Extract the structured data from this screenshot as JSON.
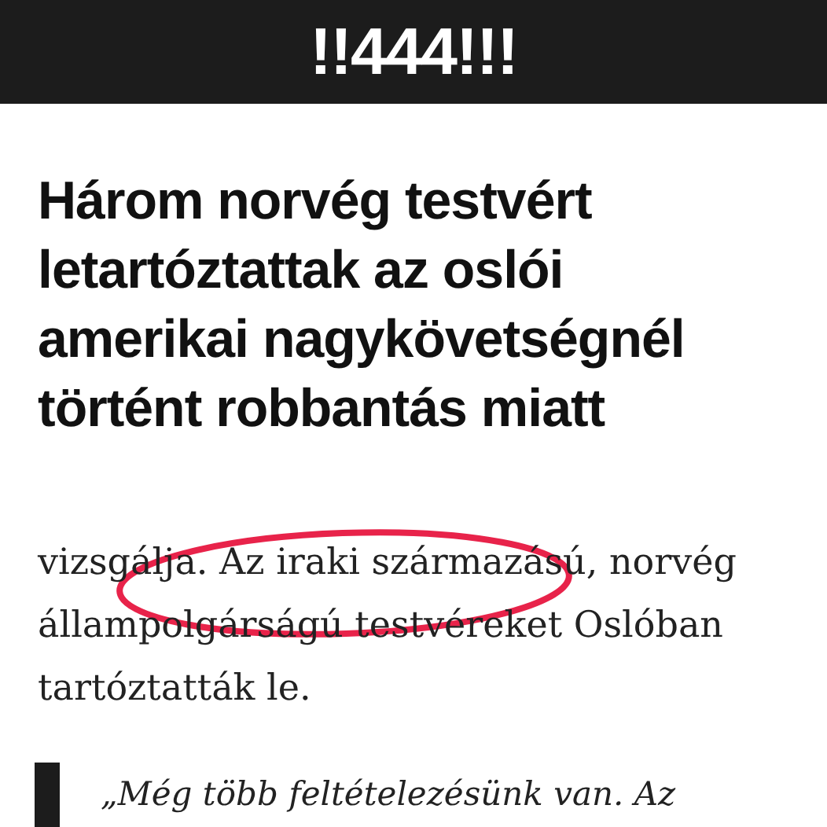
{
  "header": {
    "logo": "!!444!!!"
  },
  "article": {
    "headline": "Három norvég testvért letartóztattak az oslói amerikai nagykövetségnél történt robbantás miatt",
    "paragraph": "vizsgálja. Az iraki származású, norvég állampolgárságú testvéreket Oslóban tartóztatták le.",
    "quote": "„Még több feltételezésünk van. Az"
  },
  "annotation": {
    "kind": "circle",
    "color": "#e8234a"
  }
}
